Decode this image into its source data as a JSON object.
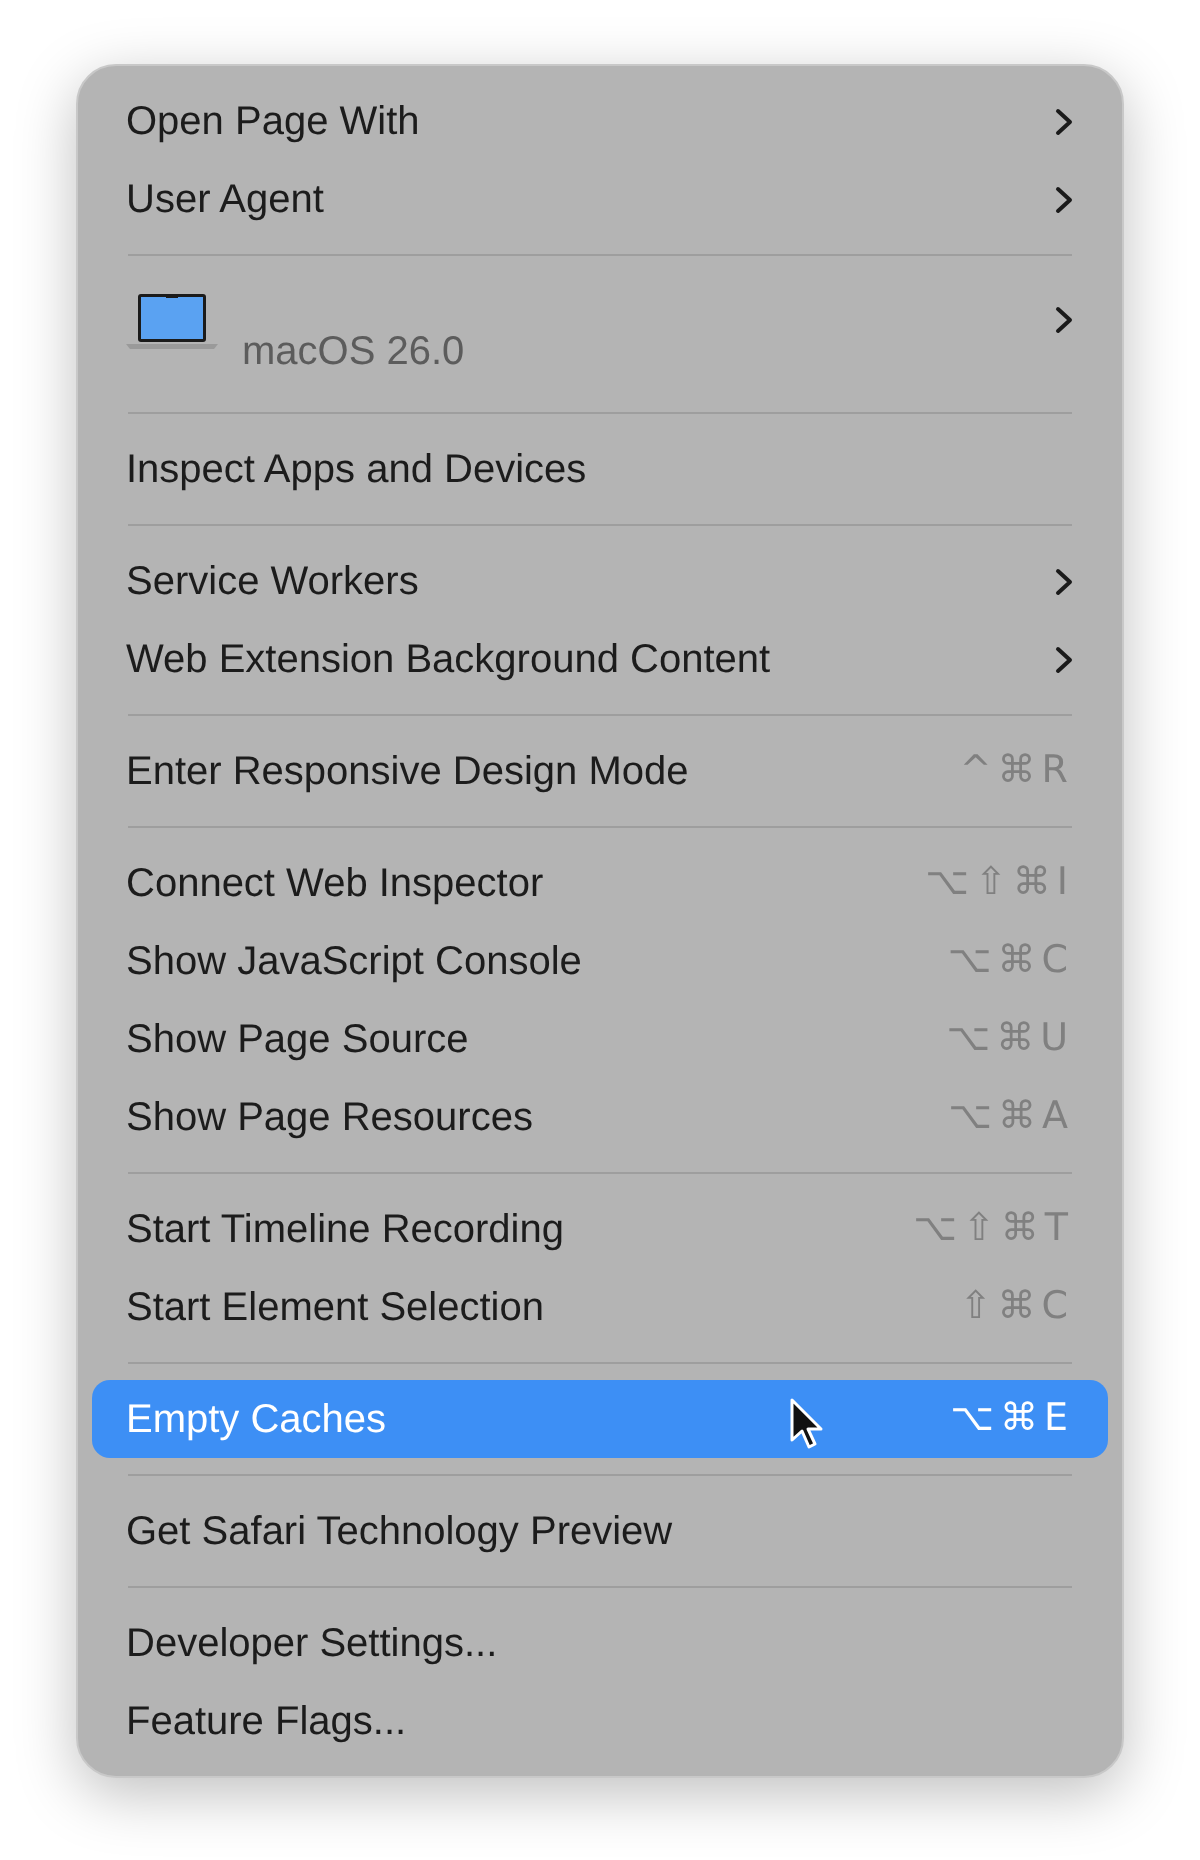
{
  "menu": {
    "sections": [
      {
        "items": [
          {
            "kind": "submenu",
            "label": "Open Page With",
            "selected": false
          },
          {
            "kind": "submenu",
            "label": "User Agent",
            "selected": false
          }
        ]
      },
      {
        "items": [
          {
            "kind": "device",
            "label": "macOS 26.0",
            "selected": false
          }
        ]
      },
      {
        "items": [
          {
            "kind": "plain",
            "label": "Inspect Apps and Devices",
            "selected": false
          }
        ]
      },
      {
        "items": [
          {
            "kind": "submenu",
            "label": "Service Workers",
            "selected": false
          },
          {
            "kind": "submenu",
            "label": "Web Extension Background Content",
            "selected": false
          }
        ]
      },
      {
        "items": [
          {
            "kind": "shortcut",
            "label": "Enter Responsive Design Mode",
            "shortcut": "^⌘R",
            "selected": false
          }
        ]
      },
      {
        "items": [
          {
            "kind": "shortcut",
            "label": "Connect Web Inspector",
            "shortcut": "⌥⇧⌘I",
            "selected": false
          },
          {
            "kind": "shortcut",
            "label": "Show JavaScript Console",
            "shortcut": "⌥⌘C",
            "selected": false
          },
          {
            "kind": "shortcut",
            "label": "Show Page Source",
            "shortcut": "⌥⌘U",
            "selected": false
          },
          {
            "kind": "shortcut",
            "label": "Show Page Resources",
            "shortcut": "⌥⌘A",
            "selected": false
          }
        ]
      },
      {
        "items": [
          {
            "kind": "shortcut",
            "label": "Start Timeline Recording",
            "shortcut": "⌥⇧⌘T",
            "selected": false
          },
          {
            "kind": "shortcut",
            "label": "Start Element Selection",
            "shortcut": "⇧⌘C",
            "selected": false
          }
        ]
      },
      {
        "items": [
          {
            "kind": "shortcut",
            "label": "Empty Caches",
            "shortcut": "⌥⌘E",
            "selected": true
          }
        ]
      },
      {
        "items": [
          {
            "kind": "plain",
            "label": "Get Safari Technology Preview",
            "selected": false
          }
        ]
      },
      {
        "items": [
          {
            "kind": "plain",
            "label": "Developer Settings...",
            "selected": false
          },
          {
            "kind": "plain",
            "label": "Feature Flags...",
            "selected": false
          }
        ]
      }
    ]
  }
}
